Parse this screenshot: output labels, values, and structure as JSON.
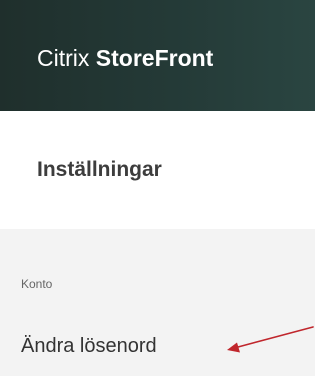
{
  "header": {
    "brand_light": "Citrix ",
    "brand_bold": "StoreFront",
    "background_color": "#243a37"
  },
  "settings": {
    "title": "Inställningar",
    "section_label": "Konto",
    "change_password_label": "Ändra lösenord"
  },
  "annotation": {
    "arrow_color": "#c0262c"
  }
}
